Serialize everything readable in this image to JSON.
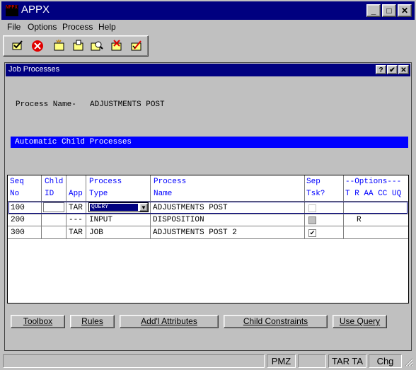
{
  "window": {
    "title": "APPX",
    "icon_text": "NPPX"
  },
  "menu": [
    {
      "label": "File"
    },
    {
      "label": "Options"
    },
    {
      "label": "Process"
    },
    {
      "label": "Help"
    }
  ],
  "toolbar": {
    "icons": [
      "confirm-icon",
      "cancel-icon",
      "new-icon",
      "open-icon",
      "inquire-icon",
      "delete-icon",
      "change-icon"
    ]
  },
  "child": {
    "title": "Job Processes",
    "process_label": "Process Name-",
    "process_value": "ADJUSTMENTS POST",
    "section_title": "Automatic Child Processes"
  },
  "table": {
    "headers": {
      "seq": [
        "Seq",
        "No"
      ],
      "chld": [
        "Chld",
        "ID"
      ],
      "app": [
        "",
        "App"
      ],
      "ptype": [
        "Process",
        "Type"
      ],
      "pname": [
        "Process",
        "Name"
      ],
      "sep": [
        "Sep",
        "Tsk?"
      ],
      "opts": [
        "--Options---",
        "T R AA CC UQ"
      ]
    },
    "rows": [
      {
        "seq": "100",
        "chld": "",
        "app": "TAR",
        "type": "QUERY",
        "name": "ADJUSTMENTS POST",
        "sep": "",
        "opts": ""
      },
      {
        "seq": "200",
        "chld": "",
        "app": "---",
        "type": "INPUT",
        "name": "DISPOSITION",
        "sep": "",
        "opts": "R"
      },
      {
        "seq": "300",
        "chld": "",
        "app": "TAR",
        "type": "JOB",
        "name": "ADJUSTMENTS POST 2",
        "sep": "✔",
        "opts": ""
      }
    ]
  },
  "buttons": [
    "Toolbox",
    "Rules",
    "Add'l Attributes",
    "Child Constraints",
    "Use Query"
  ],
  "status": {
    "s1": "",
    "s2": "PMZ",
    "s3": "",
    "s4": "TAR TA",
    "s5": "Chg"
  }
}
